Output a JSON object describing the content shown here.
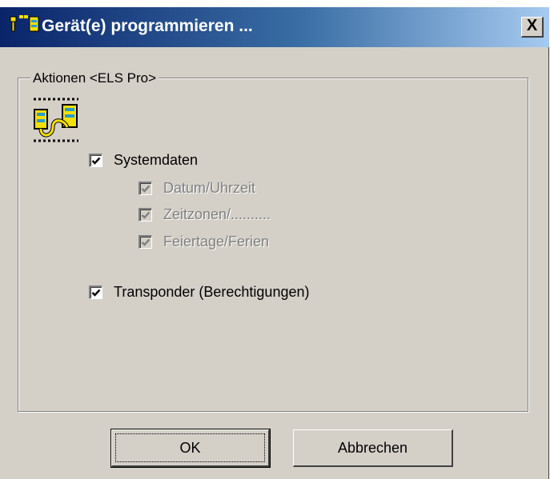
{
  "window": {
    "title": "Gerät(e) programmieren ...",
    "close_glyph": "X"
  },
  "group": {
    "legend": "Aktionen <ELS Pro>"
  },
  "checkboxes": [
    {
      "label": "Systemdaten",
      "checked": true,
      "disabled": false
    },
    {
      "label": "Datum/Uhrzeit",
      "checked": true,
      "disabled": true
    },
    {
      "label": "Zeitzonen/..........",
      "checked": true,
      "disabled": true
    },
    {
      "label": "Feiertage/Ferien",
      "checked": true,
      "disabled": true
    },
    {
      "label": "Transponder (Berechtigungen)",
      "checked": true,
      "disabled": false
    }
  ],
  "buttons": {
    "ok": "OK",
    "cancel": "Abbrechen"
  },
  "icons": {
    "app": "app-icon",
    "group": "device-link-icon",
    "close": "close-icon"
  }
}
